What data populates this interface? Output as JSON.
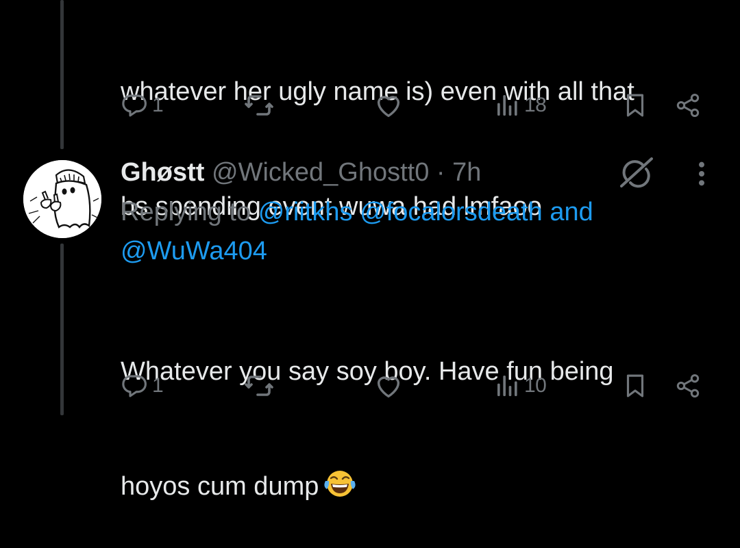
{
  "previous_tweet": {
    "text_lines": [
      "whatever her ugly name is) even with all that",
      "bs spending event wuwa had lmfaoo"
    ],
    "actions": {
      "reply_count": "1",
      "retweet_count": "",
      "like_count": "",
      "views_count": "18"
    }
  },
  "reply_tweet": {
    "author": {
      "display_name": "Ghøstt",
      "handle": "@Wicked_Ghostt0",
      "separator": "·",
      "time": "7h"
    },
    "replying_to": {
      "prefix": "Replying to",
      "mention_1": "@riitkhs",
      "mention_2": "@focalorsdeath",
      "conjunction": "and",
      "mention_3": "@WuWa404"
    },
    "text_lines": [
      "Whatever you say soy boy. Have fun being",
      "hoyos cum dump"
    ],
    "emoji": "face-with-tears-of-joy",
    "actions": {
      "reply_count": "1",
      "retweet_count": "",
      "like_count": "",
      "views_count": "10"
    }
  },
  "icons": {
    "reply": "reply-icon",
    "retweet": "retweet-icon",
    "like": "like-icon",
    "views": "views-icon",
    "bookmark": "bookmark-icon",
    "share": "share-icon",
    "grok": "grok-icon",
    "more": "more-icon"
  },
  "colors": {
    "background": "#000000",
    "text_primary": "#e7e9ea",
    "text_secondary": "#71767b",
    "link": "#1d9bf0",
    "thread_line": "#333639"
  }
}
